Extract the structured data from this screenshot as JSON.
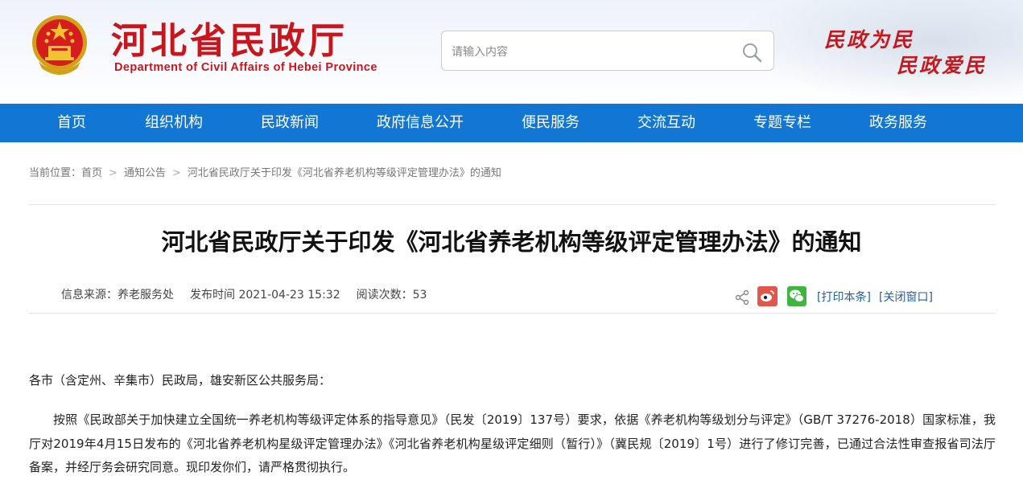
{
  "header": {
    "site_title": "河北省民政厅",
    "site_subtitle": "Department of Civil Affairs of Hebei Province",
    "slogan_line1": "民政为民",
    "slogan_line2": "民政爱民",
    "emblem_icon": "national-emblem-icon",
    "brand_color": "#c8161d"
  },
  "search": {
    "placeholder": "请输入内容",
    "value": "",
    "icon": "search-icon"
  },
  "nav": {
    "background": "#1276d4",
    "items": [
      {
        "label": "首页"
      },
      {
        "label": "组织机构"
      },
      {
        "label": "民政新闻"
      },
      {
        "label": "政府信息公开"
      },
      {
        "label": "便民服务"
      },
      {
        "label": "交流互动"
      },
      {
        "label": "专题专栏"
      },
      {
        "label": "政务服务"
      }
    ]
  },
  "breadcrumb": {
    "prefix": "当前位置：",
    "separator": ">",
    "items": [
      "首页",
      "通知公告",
      "河北省民政厅关于印发《河北省养老机构等级评定管理办法》的通知"
    ]
  },
  "article": {
    "title": "河北省民政厅关于印发《河北省养老机构等级评定管理办法》的通知",
    "source": "信息来源：养老服务处",
    "published": "发布时间 2021-04-23 15:32",
    "views": "阅读次数：53",
    "salutation": "各市（含定州、辛集市）民政局，雄安新区公共服务局：",
    "paragraph": "按照《民政部关于加快建立全国统一养老机构等级评定体系的指导意见》（民发〔2019〕137号）要求，依据《养老机构等级划分与评定》（GB/T 37276-2018）国家标准，我厅对2019年4月15日发布的《河北省养老机构星级评定管理办法》《河北省养老机构星级评定细则（暂行）》（冀民规〔2019〕1号）进行了修订完善，已通过合法性审查报省司法厅备案，并经厅务会研究同意。现印发你们，请严格贯彻执行。"
  },
  "tools": {
    "share_icon": "share-icon",
    "weibo_icon": "weibo-icon",
    "wechat_icon": "wechat-icon",
    "print_label": "[打印本条]",
    "close_label": "[关闭窗口]"
  }
}
